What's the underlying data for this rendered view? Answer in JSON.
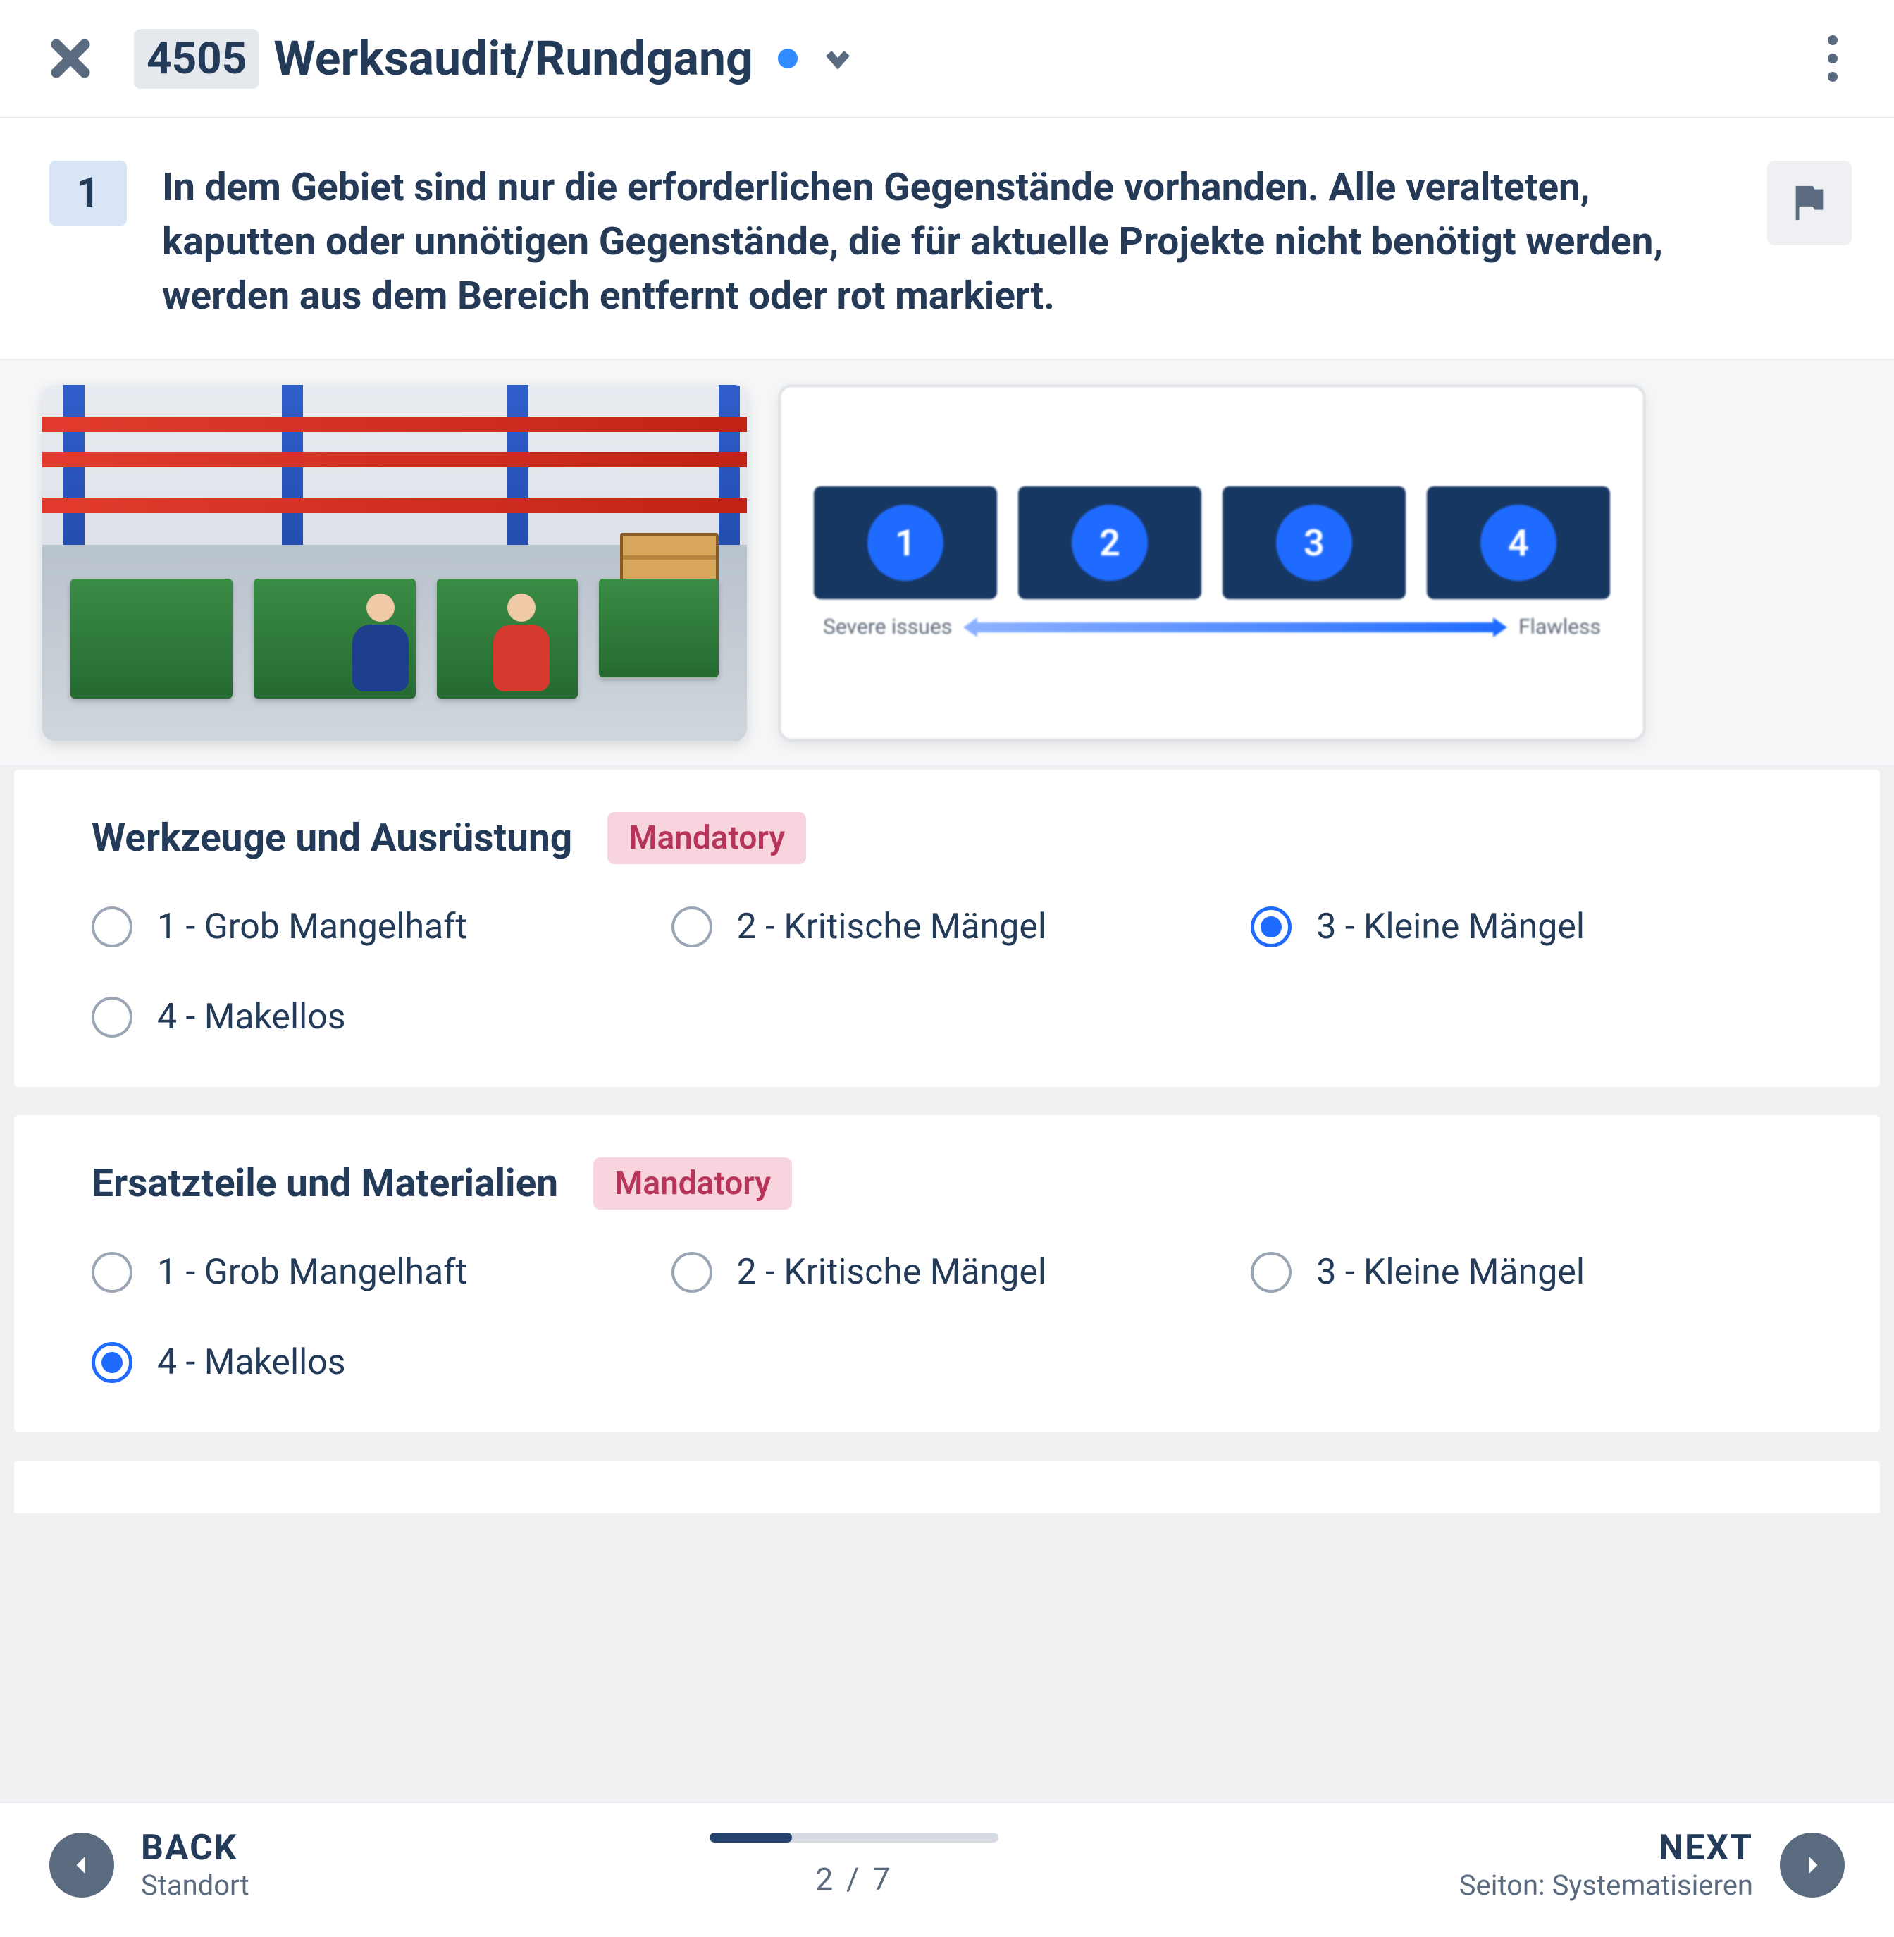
{
  "header": {
    "id_badge": "4505",
    "title": "Werksaudit/Rundgang"
  },
  "question": {
    "number": "1",
    "text": "In dem Gebiet sind nur die erforderlichen Gegenstände vorhanden. Alle veralteten, kaputten oder unnötigen Gegenstände, die für aktuelle Projekte nicht benötigt werden, werden aus dem Bereich entfernt oder rot markiert."
  },
  "scale_preview": {
    "items": [
      "1",
      "2",
      "3",
      "4"
    ],
    "left_label": "Severe issues",
    "right_label": "Flawless"
  },
  "sections": [
    {
      "title": "Werkzeuge und Ausrüstung",
      "badge": "Mandatory",
      "options": [
        "1 - Grob Mangelhaft",
        "2 - Kritische Mängel",
        "3 - Kleine Mängel",
        "4 - Makellos"
      ],
      "selected_index": 2
    },
    {
      "title": "Ersatzteile und Materialien",
      "badge": "Mandatory",
      "options": [
        "1 - Grob Mangelhaft",
        "2 - Kritische Mängel",
        "3 - Kleine Mängel",
        "4 - Makellos"
      ],
      "selected_index": 3
    }
  ],
  "footer": {
    "back_label": "BACK",
    "back_sub": "Standort",
    "next_label": "NEXT",
    "next_sub": "Seiton: Systematisieren",
    "progress_current": 2,
    "progress_total": 7,
    "progress_text": "2 / 7"
  }
}
